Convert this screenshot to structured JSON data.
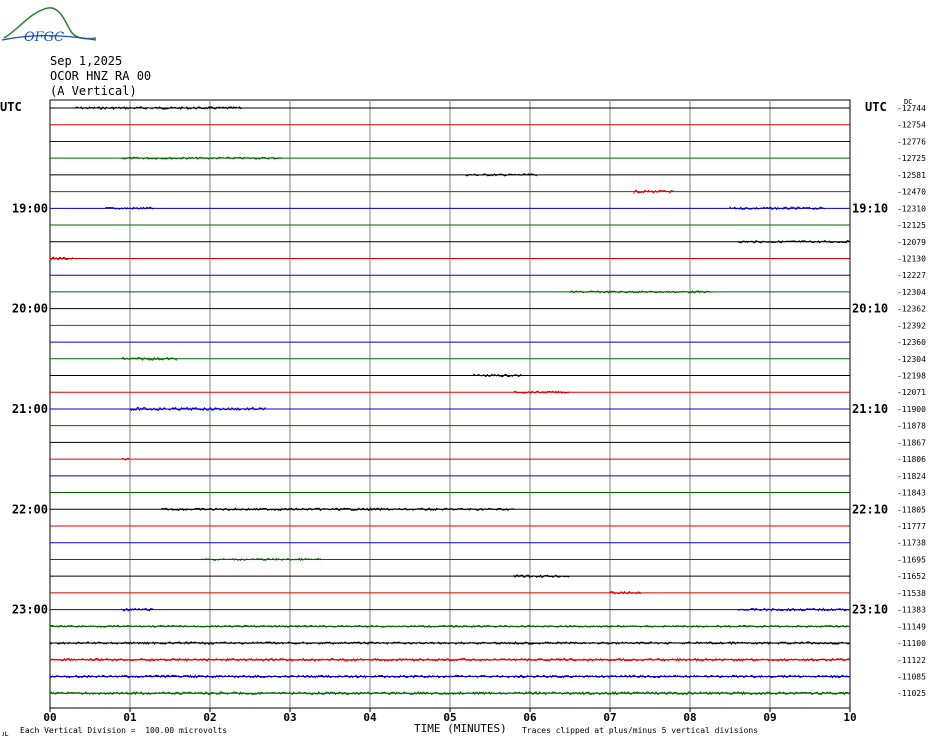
{
  "header": {
    "date": "Sep 1,2025",
    "station": "OCOR HNZ RA 00",
    "component": "(A Vertical)",
    "utc_left": "UTC",
    "utc_right": "UTC",
    "logo_text": "OFGC"
  },
  "footer": {
    "scale_note": "Each Vertical Division =  100.00 microvolts",
    "x_title": "TIME (MINUTES)",
    "clip_note": "Traces clipped at plus/minus 5 vertical divisions",
    "mark": "ᴊʟ"
  },
  "colors": {
    "trace_cycle": [
      "#000000",
      "#dd0000",
      "#0000cc",
      "#006600"
    ],
    "grid": "#808080"
  },
  "chart_data": {
    "type": "line",
    "title": "",
    "xlabel": "TIME (MINUTES)",
    "ylabel": "",
    "x_ticks": [
      "00",
      "01",
      "02",
      "03",
      "04",
      "05",
      "06",
      "07",
      "08",
      "09",
      "10"
    ],
    "xlim": [
      0,
      10
    ],
    "grid": true,
    "left_time_labels": [
      {
        "row": 6,
        "label": "19:00"
      },
      {
        "row": 12,
        "label": "20:00"
      },
      {
        "row": 18,
        "label": "21:00"
      },
      {
        "row": 24,
        "label": "22:00"
      },
      {
        "row": 30,
        "label": "23:00"
      }
    ],
    "right_time_labels": [
      {
        "row": 6,
        "label": "19:10"
      },
      {
        "row": 12,
        "label": "20:10"
      },
      {
        "row": 18,
        "label": "21:10"
      },
      {
        "row": 24,
        "label": "22:10"
      },
      {
        "row": 30,
        "label": "23:10"
      }
    ],
    "dc_header": "DC",
    "dc_offsets": [
      "-12744",
      "-12754",
      "-12776",
      "-12725",
      "-12581",
      "-12470",
      "-12310",
      "-12125",
      "-12079",
      "-12130",
      "-12227",
      "-12304",
      "-12362",
      "-12392",
      "-12360",
      "-12304",
      "-12198",
      "-12071",
      "-11900",
      "-11878",
      "-11867",
      "-11806",
      "-11824",
      "-11843",
      "-11805",
      "-11777",
      "-11738",
      "-11695",
      "-11652",
      "-11538",
      "-11383",
      "-11149",
      "-11100",
      "-11122",
      "-11085",
      "-11025"
    ],
    "noise_bursts": [
      {
        "row": 0,
        "x0": 0.3,
        "x1": 2.4,
        "amp": 1.2
      },
      {
        "row": 3,
        "x0": 0.9,
        "x1": 2.9,
        "amp": 1.0
      },
      {
        "row": 4,
        "x0": 5.2,
        "x1": 6.1,
        "amp": 1.1
      },
      {
        "row": 5,
        "x0": 7.3,
        "x1": 7.8,
        "amp": 1.3
      },
      {
        "row": 6,
        "x0": 0.7,
        "x1": 1.3,
        "amp": 1.2
      },
      {
        "row": 6,
        "x0": 8.5,
        "x1": 9.7,
        "amp": 1.2
      },
      {
        "row": 8,
        "x0": 8.6,
        "x1": 10.0,
        "amp": 1.1
      },
      {
        "row": 9,
        "x0": 0.0,
        "x1": 0.3,
        "amp": 1.4
      },
      {
        "row": 11,
        "x0": 6.5,
        "x1": 8.3,
        "amp": 1.0
      },
      {
        "row": 15,
        "x0": 0.9,
        "x1": 1.6,
        "amp": 1.3
      },
      {
        "row": 16,
        "x0": 5.3,
        "x1": 5.9,
        "amp": 1.2
      },
      {
        "row": 17,
        "x0": 5.8,
        "x1": 6.5,
        "amp": 1.0
      },
      {
        "row": 18,
        "x0": 1.0,
        "x1": 2.7,
        "amp": 1.4
      },
      {
        "row": 21,
        "x0": 0.9,
        "x1": 1.0,
        "amp": 1.0
      },
      {
        "row": 24,
        "x0": 1.4,
        "x1": 5.8,
        "amp": 1.1
      },
      {
        "row": 27,
        "x0": 1.9,
        "x1": 3.4,
        "amp": 0.9
      },
      {
        "row": 28,
        "x0": 5.8,
        "x1": 6.5,
        "amp": 1.2
      },
      {
        "row": 29,
        "x0": 7.0,
        "x1": 7.4,
        "amp": 1.3
      },
      {
        "row": 30,
        "x0": 0.9,
        "x1": 1.3,
        "amp": 1.3
      },
      {
        "row": 30,
        "x0": 8.6,
        "x1": 10.0,
        "amp": 1.2
      },
      {
        "row": 31,
        "x0": 0.0,
        "x1": 10.0,
        "amp": 0.9
      },
      {
        "row": 32,
        "x0": 0.0,
        "x1": 10.0,
        "amp": 1.1
      },
      {
        "row": 33,
        "x0": 0.0,
        "x1": 10.0,
        "amp": 1.2
      },
      {
        "row": 34,
        "x0": 0.0,
        "x1": 10.0,
        "amp": 1.2
      },
      {
        "row": 35,
        "x0": 0.0,
        "x1": 10.0,
        "amp": 1.3
      }
    ]
  }
}
